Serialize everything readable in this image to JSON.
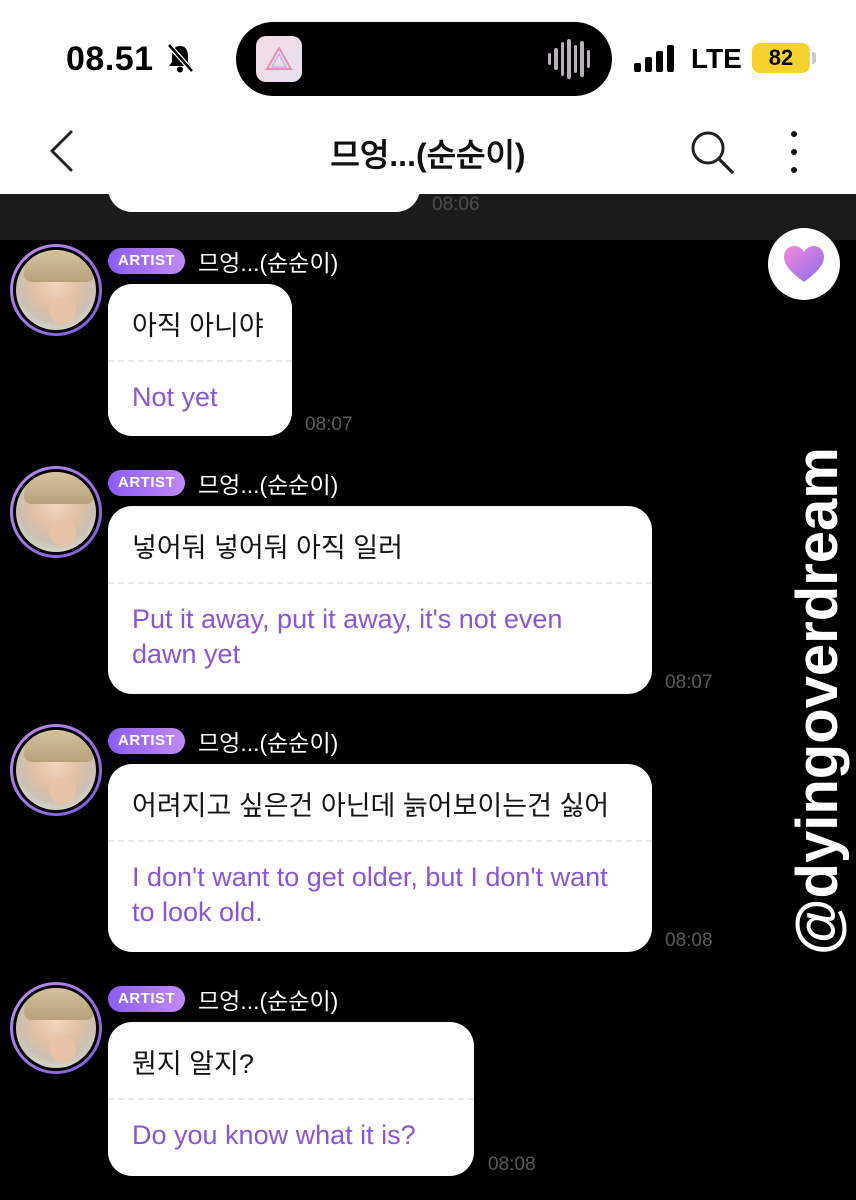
{
  "status_bar": {
    "time": "08.51",
    "network": "LTE",
    "battery": "82"
  },
  "header": {
    "title": "므엉...(순순이)"
  },
  "previous": {
    "time": "08:06"
  },
  "messages": [
    {
      "badge": "ARTIST",
      "sender": "므엉...(순순이)",
      "text_ko": "아직 아니야",
      "text_en": "Not yet",
      "time": "08:07"
    },
    {
      "badge": "ARTIST",
      "sender": "므엉...(순순이)",
      "text_ko": "넣어둬 넣어둬 아직 일러",
      "text_en": "Put it away, put it away, it's not even dawn yet",
      "time": "08:07"
    },
    {
      "badge": "ARTIST",
      "sender": "므엉...(순순이)",
      "text_ko": "어려지고 싶은건 아닌데 늙어보이는건 싫어",
      "text_en": "I don't want to get older, but I don't want to look old.",
      "time": "08:08"
    },
    {
      "badge": "ARTIST",
      "sender": "므엉...(순순이)",
      "text_ko": "뭔지 알지?",
      "text_en": "Do you know what it is?",
      "time": "08:08"
    }
  ],
  "watermark": "@dyingoverdream",
  "colors": {
    "translation": "#8b55d9",
    "badge_start": "#8b5cf6",
    "badge_end": "#c08bf5",
    "battery": "#f7d12e"
  },
  "icons": [
    "bell-slash-icon",
    "signal-icon",
    "back-icon",
    "search-icon",
    "more-icon",
    "heart-icon"
  ]
}
